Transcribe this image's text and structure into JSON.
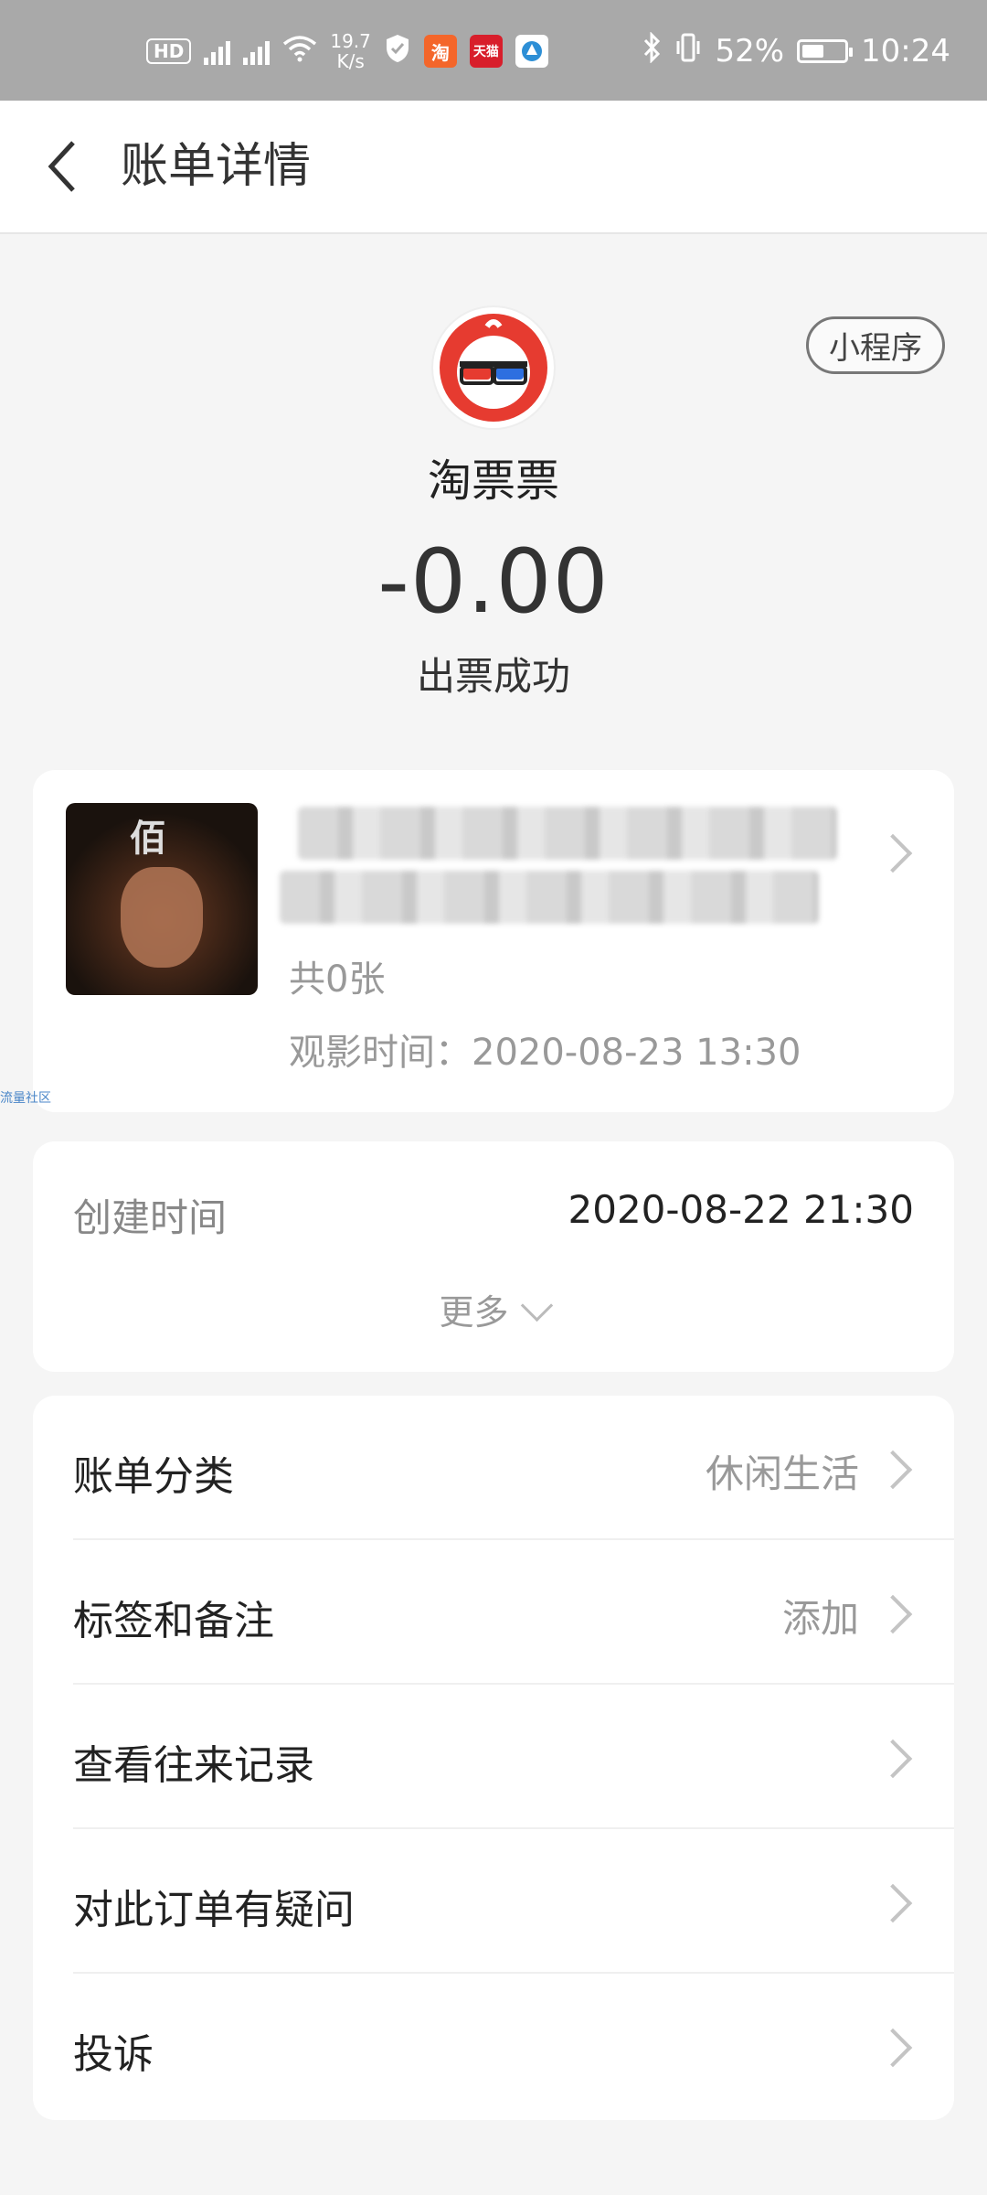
{
  "status_bar": {
    "network_speed": "19.7",
    "network_unit": "K/s",
    "battery": "52%",
    "battery_level": 0.52,
    "time": "10:24",
    "app_icon_taobao": "淘",
    "app_icon_tmall": "天猫",
    "icons": [
      "hd-icon",
      "signal-4g-icon",
      "signal-4g-icon-2",
      "wifi-icon",
      "shield-icon",
      "taobao-icon",
      "tmall-icon",
      "browser-icon",
      "bluetooth-icon",
      "vibrate-icon",
      "battery-icon"
    ]
  },
  "header": {
    "title": "账单详情"
  },
  "summary": {
    "badge": "小程序",
    "merchant": "淘票票",
    "amount": "-0.00",
    "status": "出票成功"
  },
  "order": {
    "count_text": "共0张",
    "show_time_text": "观影时间：2020-08-23 13:30"
  },
  "details": {
    "created_label": "创建时间",
    "created_value": "2020-08-22 21:30",
    "more_label": "更多"
  },
  "list": [
    {
      "label": "账单分类",
      "value": "休闲生活"
    },
    {
      "label": "标签和备注",
      "value": "添加"
    },
    {
      "label": "查看往来记录",
      "value": ""
    },
    {
      "label": "对此订单有疑问",
      "value": ""
    },
    {
      "label": "投诉",
      "value": ""
    }
  ],
  "watermark": "流量社区",
  "colors": {
    "status_bar_bg": "#a9a9a9",
    "logo_red": "#e63b30",
    "page_bg": "#f5f5f5"
  }
}
